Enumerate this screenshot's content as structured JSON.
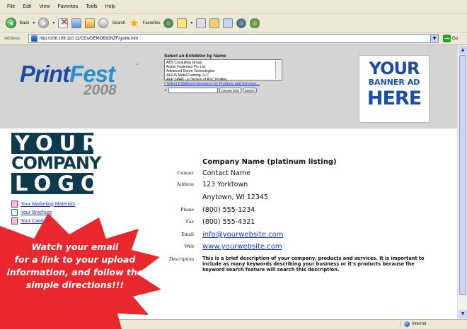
{
  "browser": {
    "menu": [
      "File",
      "Edit",
      "View",
      "Favorites",
      "Tools",
      "Help"
    ],
    "toolbar": {
      "back_label": "Back",
      "search_label": "Search",
      "favorites_label": "Favorites"
    },
    "address": {
      "label": "Address",
      "url": "http://208.109.110.12/CDs/DEMOBIGNZF/guide.htm",
      "go_label": "Go"
    },
    "status": {
      "zone_label": "Internet"
    }
  },
  "header": {
    "logo": {
      "word1": "Print",
      "word2": "Fest",
      "tm": "™",
      "year": "2008"
    },
    "exhibitor_search": {
      "heading": "Select an Exhibitor by Name",
      "options": [
        "ABS Consulting Group",
        "Action Fasteners Pty Ltd.",
        "Advanced Green Technologies",
        "AEGIS Metal Framing, LLC",
        "AEP SPAN - a Division of ASC Profiles"
      ],
      "products_link": "Select Exhibitors/Sponsors by Products and Services...",
      "field_select": "Choose field",
      "search_button": "Search"
    },
    "banner": {
      "line1": "YOUR",
      "line2": "BANNER AD",
      "line3": "HERE"
    }
  },
  "company_logo": {
    "line1": "YOUR",
    "line2": "COMPANY",
    "line3": "LOGO"
  },
  "side_links": [
    {
      "label": "Your Marketing Materials",
      "icon": "pdf-icon"
    },
    {
      "label": "Your Brochure",
      "icon": "word-doc-icon"
    },
    {
      "label": "Your Catalog",
      "icon": "pdf-icon"
    }
  ],
  "listing": {
    "title": "Company Name (platinum listing)",
    "contact_label": "Contact",
    "contact": "Contact Name",
    "address_label": "Address",
    "address1": "123 Yorktown",
    "address2": "Anytown, WI 12345",
    "phone_label": "Phone",
    "phone": "(800) 555-1234",
    "fax_label": "Fax",
    "fax": "(800) 555-4321",
    "email_label": "Email",
    "email": "info@yourwebsite.com",
    "web_label": "Web",
    "web": "www.yourwebsite.com",
    "description_label": "Description",
    "description": "This is a brief description of your company, products and services. It is important to include as many keywords describing your business or it's products because the keyword search feature will search this description."
  },
  "callout": {
    "line1": "Watch your email",
    "line2": "for a link to your upload",
    "line3": "information, and follow the",
    "line4": "simple directions!!!",
    "color": "#e8282c"
  }
}
